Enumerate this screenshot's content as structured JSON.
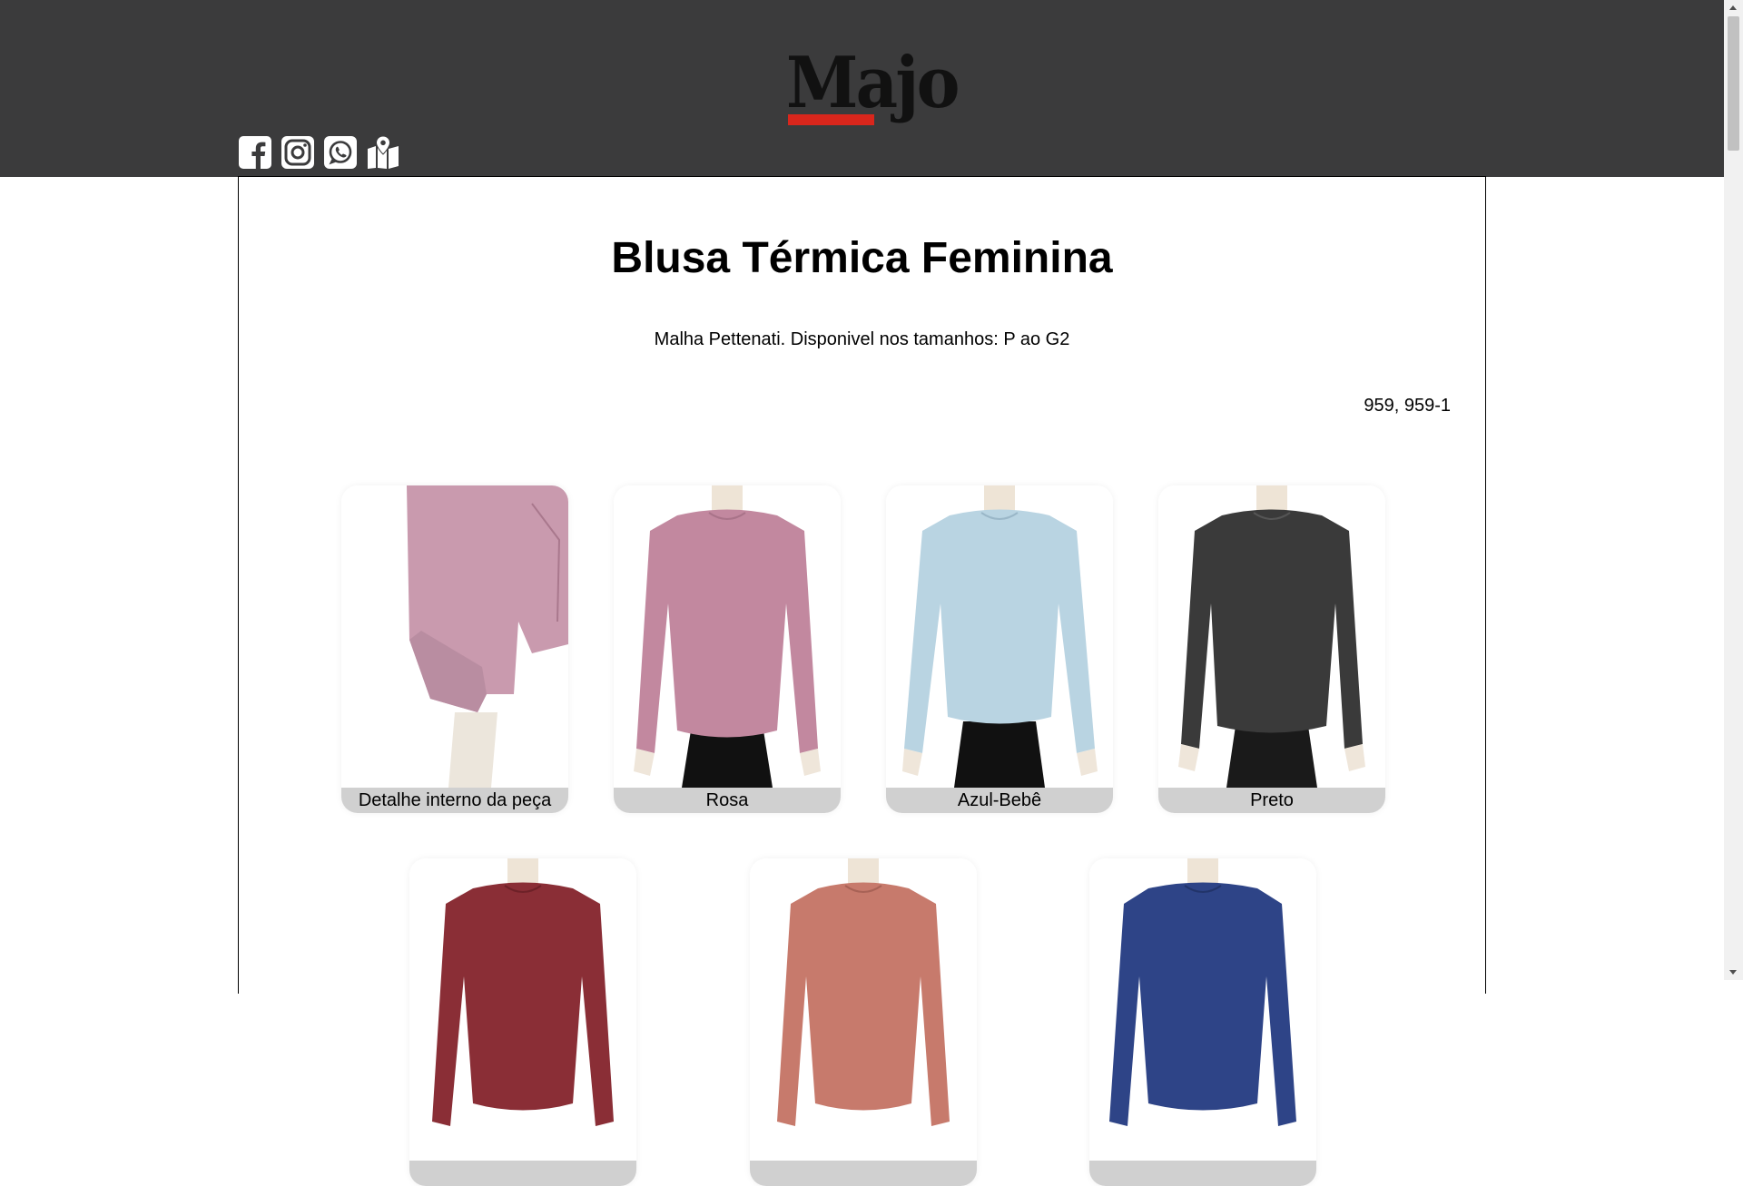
{
  "brand": {
    "logo_text": "Majo",
    "accent": "#d9261c"
  },
  "socials": [
    {
      "icon": "facebook-icon"
    },
    {
      "icon": "instagram-icon"
    },
    {
      "icon": "whatsapp-icon"
    },
    {
      "icon": "map-icon"
    }
  ],
  "product": {
    "title": "Blusa Térmica Feminina",
    "description": "Malha Pettenati. Disponivel nos tamanhos: P ao G2",
    "codes": "959, 959-1"
  },
  "variants": [
    {
      "label": "Detalhe interno da peça",
      "color": "#c99aae"
    },
    {
      "label": "Rosa",
      "color": "#c2889f"
    },
    {
      "label": "Azul-Bebê",
      "color": "#b9d4e2"
    },
    {
      "label": "Preto",
      "color": "#3a3a3a"
    },
    {
      "label": "",
      "color": "#8a2e36"
    },
    {
      "label": "",
      "color": "#c77a6c"
    },
    {
      "label": "",
      "color": "#2e4487"
    }
  ],
  "colors": {
    "header_bg": "#3b3b3c",
    "caption_bg": "#d0d0d0"
  }
}
